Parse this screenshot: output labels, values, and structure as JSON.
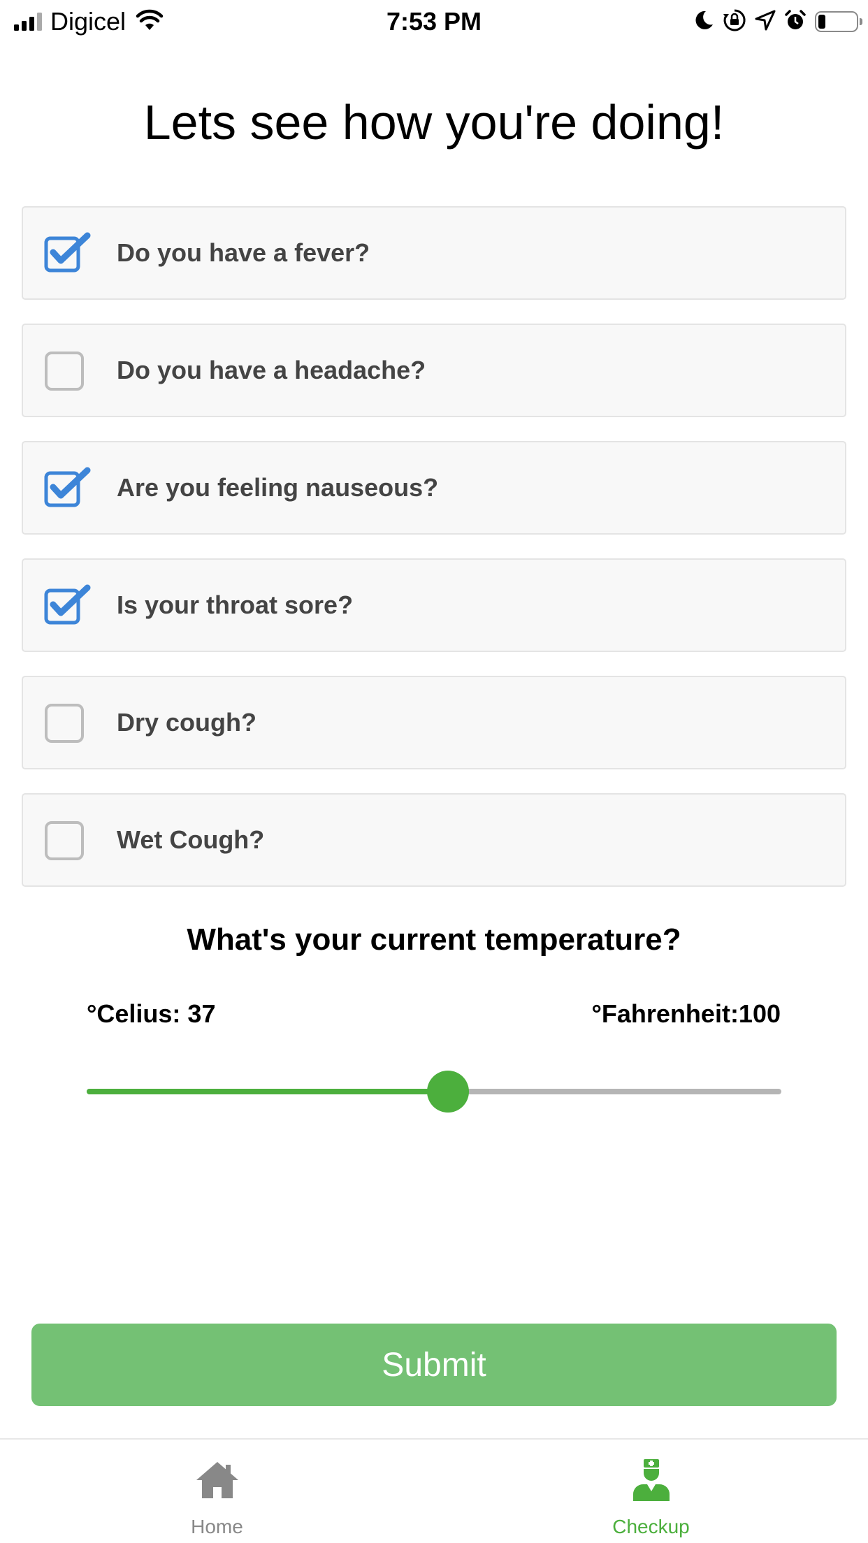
{
  "status_bar": {
    "carrier": "Digicel",
    "time": "7:53 PM"
  },
  "page": {
    "title": "Lets see how you're doing!"
  },
  "questions": [
    {
      "label": "Do you have a fever?",
      "checked": true
    },
    {
      "label": "Do you have a headache?",
      "checked": false
    },
    {
      "label": "Are you feeling nauseous?",
      "checked": true
    },
    {
      "label": "Is your throat sore?",
      "checked": true
    },
    {
      "label": "Dry cough?",
      "checked": false
    },
    {
      "label": "Wet Cough?",
      "checked": false
    }
  ],
  "temperature": {
    "title": "What's your current temperature?",
    "celsius_text": "°Celius: 37",
    "fahrenheit_text": "°Fahrenheit:100",
    "slider_fraction": 0.52
  },
  "submit": {
    "label": "Submit"
  },
  "tab_bar": {
    "tabs": [
      {
        "label": "Home",
        "icon": "home-icon",
        "active": false
      },
      {
        "label": "Checkup",
        "icon": "doctor-icon",
        "active": true
      }
    ]
  },
  "colors": {
    "accent_green": "#4caf3d",
    "submit_green": "#74c174",
    "checkbox_blue": "#3d85d8",
    "inactive_gray": "#888888"
  }
}
